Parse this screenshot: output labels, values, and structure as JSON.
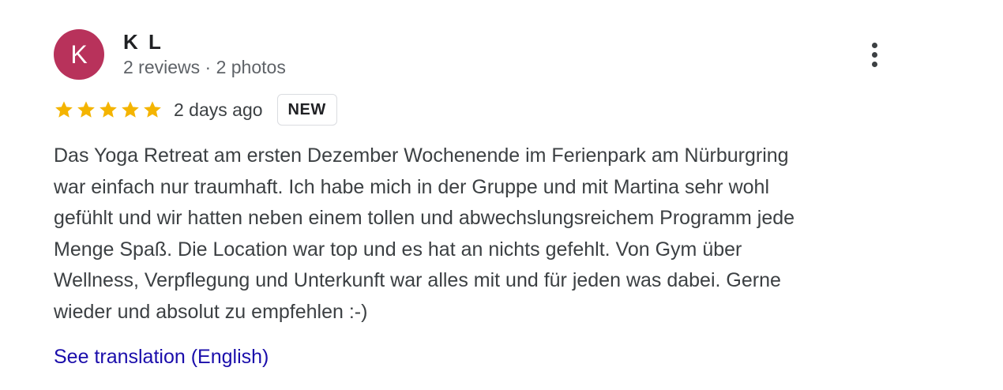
{
  "reviewer": {
    "avatar_initial": "K",
    "avatar_color": "#b8325b",
    "name": "K L",
    "meta": "2 reviews · 2 photos"
  },
  "menu": {
    "icon": "more-vert-icon"
  },
  "rating": {
    "stars": 5,
    "max_stars": 5,
    "star_color": "#f4b400",
    "star_icon": "star-icon",
    "date": "2 days ago",
    "badge": "NEW"
  },
  "review": {
    "text": "Das Yoga Retreat am ersten Dezember Wochenende im Ferienpark am Nürburgring\nwar einfach nur traumhaft. Ich habe mich in der Gruppe und mit Martina sehr wohl\ngefühlt und wir hatten neben einem tollen und abwechslungsreichem Programm jede\nMenge Spaß. Die Location war top und es hat an nichts gefehlt. Von Gym über\nWellness, Verpflegung und Unterkunft war alles mit und für jeden was dabei. Gerne\nwieder und absolut zu empfehlen :-)"
  },
  "translation": {
    "link_label": "See translation (English)",
    "link_color": "#1a0dab"
  }
}
